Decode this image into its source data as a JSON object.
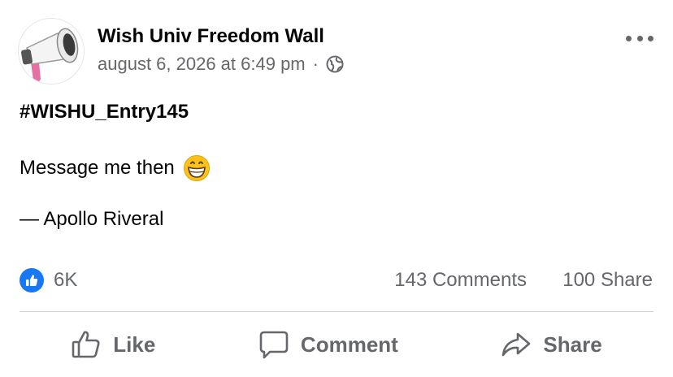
{
  "post": {
    "page_name": "Wish Univ Freedom Wall",
    "timestamp": "august 6, 2026 at 6:49 pm",
    "separator": "·",
    "audience_icon": "globe-icon",
    "hashtag": "#WISHU_Entry145",
    "message": "Message me then",
    "message_emoji": "grinning-face-emoji",
    "signature": "— Apollo Riveral"
  },
  "stats": {
    "reaction_icon": "like-icon",
    "reactions": "6K",
    "comments": "143 Comments",
    "shares": "100 Share"
  },
  "actions": {
    "like_label": "Like",
    "comment_label": "Comment",
    "share_label": "Share"
  },
  "colors": {
    "primary_text": "#050505",
    "secondary_text": "#65676b",
    "like_blue": "#1877f2",
    "divider": "#ced0d4"
  }
}
